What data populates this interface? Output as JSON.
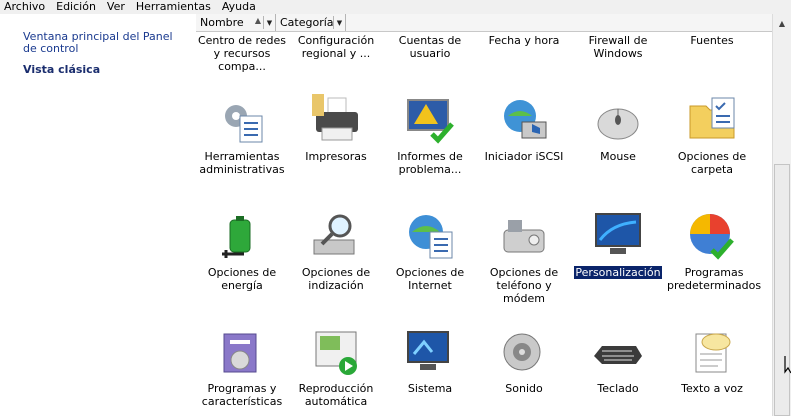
{
  "menu": {
    "items": [
      "Archivo",
      "Edición",
      "Ver",
      "Herramientas",
      "Ayuda"
    ]
  },
  "left_pane": {
    "main_link": "Ventana principal del Panel de control",
    "classic_view": "Vista clásica"
  },
  "columns": {
    "name": "Nombre",
    "category": "Categoría"
  },
  "items": [
    {
      "label": "Centro de redes y recursos compa...",
      "icon": "network-center-icon"
    },
    {
      "label": "Configuración regional y ...",
      "icon": "regional-icon"
    },
    {
      "label": "Cuentas de usuario",
      "icon": "user-accounts-icon"
    },
    {
      "label": "Fecha y hora",
      "icon": "date-time-icon"
    },
    {
      "label": "Firewall de Windows",
      "icon": "firewall-icon"
    },
    {
      "label": "Fuentes",
      "icon": "fonts-icon"
    },
    {
      "label": "Herramientas administrativas",
      "icon": "admin-tools-icon"
    },
    {
      "label": "Impresoras",
      "icon": "printer-icon"
    },
    {
      "label": "Informes de problema...",
      "icon": "problem-reports-icon"
    },
    {
      "label": "Iniciador iSCSI",
      "icon": "iscsi-icon"
    },
    {
      "label": "Mouse",
      "icon": "mouse-icon"
    },
    {
      "label": "Opciones de carpeta",
      "icon": "folder-options-icon"
    },
    {
      "label": "Opciones de energía",
      "icon": "power-options-icon"
    },
    {
      "label": "Opciones de indización",
      "icon": "indexing-icon"
    },
    {
      "label": "Opciones de Internet",
      "icon": "internet-options-icon"
    },
    {
      "label": "Opciones de teléfono y módem",
      "icon": "phone-modem-icon"
    },
    {
      "label": "Personalización",
      "icon": "personalization-icon",
      "selected": true
    },
    {
      "label": "Programas predeterminados",
      "icon": "default-programs-icon"
    },
    {
      "label": "Programas y características",
      "icon": "programs-features-icon"
    },
    {
      "label": "Reproducción automática",
      "icon": "autoplay-icon"
    },
    {
      "label": "Sistema",
      "icon": "system-icon"
    },
    {
      "label": "Sonido",
      "icon": "sound-icon"
    },
    {
      "label": "Teclado",
      "icon": "keyboard-icon"
    },
    {
      "label": "Texto a voz",
      "icon": "text-to-speech-icon"
    }
  ],
  "colors": {
    "selection": "#0a246a",
    "link": "#1a3a8f"
  }
}
